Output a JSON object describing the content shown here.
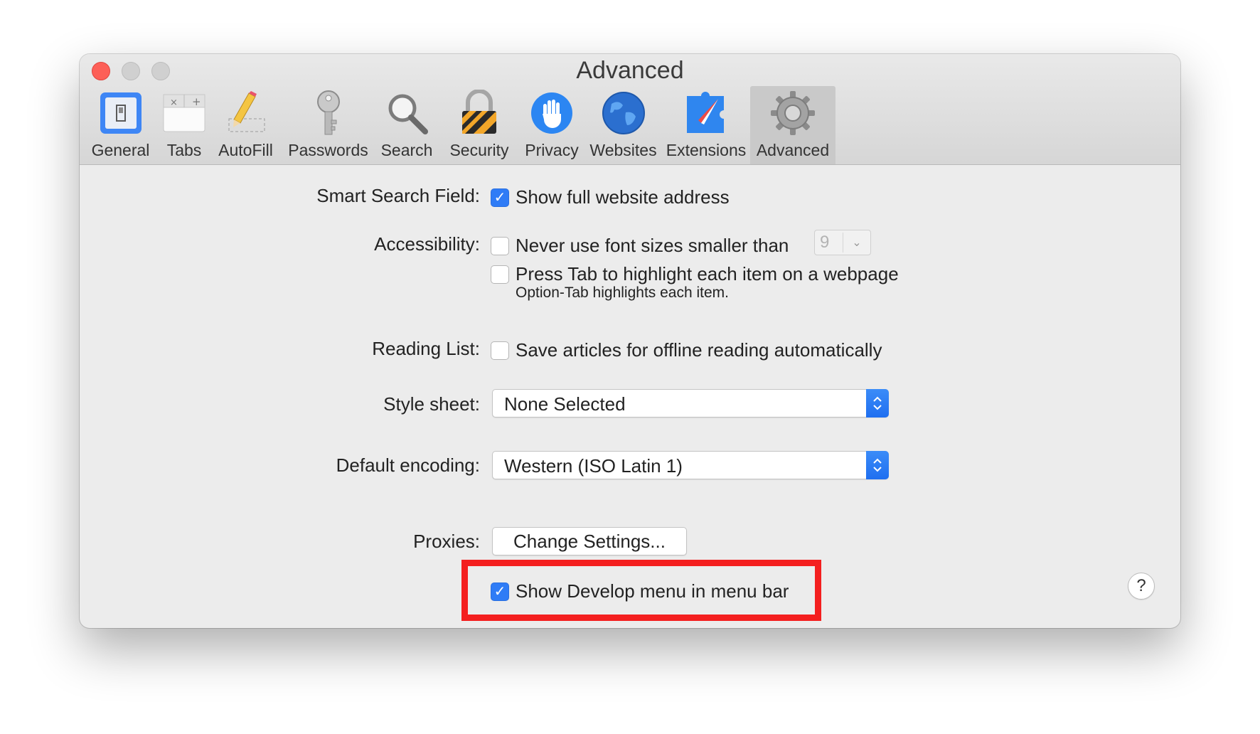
{
  "window": {
    "title": "Advanced"
  },
  "toolbar": {
    "items": [
      {
        "label": "General",
        "icon": "general-icon"
      },
      {
        "label": "Tabs",
        "icon": "tabs-icon"
      },
      {
        "label": "AutoFill",
        "icon": "autofill-pencil-icon"
      },
      {
        "label": "Passwords",
        "icon": "key-icon"
      },
      {
        "label": "Search",
        "icon": "magnifier-icon"
      },
      {
        "label": "Security",
        "icon": "lock-icon"
      },
      {
        "label": "Privacy",
        "icon": "hand-icon"
      },
      {
        "label": "Websites",
        "icon": "globe-icon"
      },
      {
        "label": "Extensions",
        "icon": "puzzle-compass-icon"
      },
      {
        "label": "Advanced",
        "icon": "gear-icon",
        "selected": true
      }
    ]
  },
  "settings": {
    "smart_search": {
      "label": "Smart Search Field:",
      "option": "Show full website address",
      "checked": true
    },
    "accessibility": {
      "label": "Accessibility:",
      "font_option": "Never use font sizes smaller than",
      "font_checked": false,
      "font_size": "9",
      "tab_option": "Press Tab to highlight each item on a webpage",
      "tab_checked": false,
      "tab_note": "Option-Tab highlights each item."
    },
    "reading_list": {
      "label": "Reading List:",
      "option": "Save articles for offline reading automatically",
      "checked": false
    },
    "style_sheet": {
      "label": "Style sheet:",
      "value": "None Selected"
    },
    "encoding": {
      "label": "Default encoding:",
      "value": "Western (ISO Latin 1)"
    },
    "proxies": {
      "label": "Proxies:",
      "button": "Change Settings..."
    },
    "develop": {
      "option": "Show Develop menu in menu bar",
      "checked": true
    }
  },
  "help": {
    "label": "?"
  },
  "colors": {
    "accent": "#2f7cf6",
    "highlight_box": "#f41f1f",
    "close_button": "#fd5f57"
  }
}
